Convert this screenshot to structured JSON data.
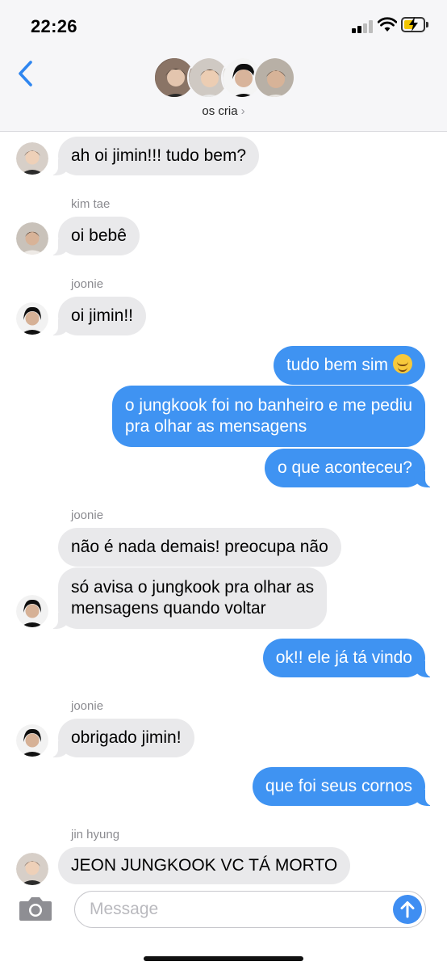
{
  "status_bar": {
    "time": "22:26"
  },
  "header": {
    "group_name": "os cria",
    "chevron": "›"
  },
  "composer": {
    "placeholder": "Message"
  },
  "colors": {
    "outgoing": "#3f93f2",
    "incoming": "#e9e9eb",
    "header_bg": "#f6f6f8"
  },
  "icons": [
    "back-chevron-icon",
    "cellular-signal-icon",
    "wifi-icon",
    "battery-charging-icon",
    "camera-icon",
    "send-arrow-icon",
    "relieved-face-emoji-icon"
  ],
  "messages": [
    {
      "direction": "incoming",
      "text": "ah oi jimin!!! tudo bem?"
    },
    {
      "direction": "incoming",
      "sender": "kim tae",
      "text": "oi bebê"
    },
    {
      "direction": "incoming",
      "sender": "joonie",
      "text": "oi jimin!!"
    },
    {
      "direction": "outgoing",
      "text": "tudo bem sim"
    },
    {
      "direction": "outgoing",
      "line1": "o jungkook foi no banheiro e me pediu",
      "line2": "pra olhar as mensagens"
    },
    {
      "direction": "outgoing",
      "text": "o que aconteceu?"
    },
    {
      "direction": "incoming",
      "sender": "joonie",
      "text": "não é nada demais! preocupa não"
    },
    {
      "direction": "incoming",
      "line1": "só avisa o jungkook pra olhar as",
      "line2": "mensagens quando voltar"
    },
    {
      "direction": "outgoing",
      "text": "ok!! ele já tá vindo"
    },
    {
      "direction": "incoming",
      "sender": "joonie",
      "text": "obrigado jimin!"
    },
    {
      "direction": "outgoing",
      "text": "que foi seus cornos"
    },
    {
      "direction": "incoming",
      "sender": "jin hyung",
      "text": "JEON JUNGKOOK VC TÁ MORTO"
    }
  ]
}
